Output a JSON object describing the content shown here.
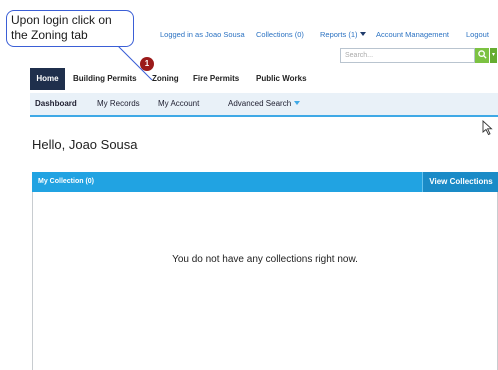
{
  "callout": {
    "text": "Upon login click on the Zoning tab",
    "step_number": "1"
  },
  "topbar": {
    "logged_in": "Logged in as Joao Sousa",
    "collections": "Collections (0)",
    "reports": "Reports (1)",
    "account_management": "Account Management",
    "logout": "Logout"
  },
  "search": {
    "placeholder": "Search..."
  },
  "module_tabs": [
    "Home",
    "Building Permits",
    "Zoning",
    "Fire Permits",
    "Public Works"
  ],
  "sub_nav": [
    "Dashboard",
    "My Records",
    "My Account",
    "Advanced Search"
  ],
  "greeting": "Hello, Joao Sousa",
  "collection_panel": {
    "title": "My Collection (0)",
    "view_button": "View Collections",
    "empty_message": "You do not have any collections right now."
  },
  "colors": {
    "accent": "#21a3e2",
    "home_tab": "#1f2f4c",
    "badge": "#9b1a1a",
    "search_button": "#7cc242"
  },
  "icons": [
    "search-icon",
    "chevron-down-icon",
    "mouse-cursor-icon"
  ]
}
